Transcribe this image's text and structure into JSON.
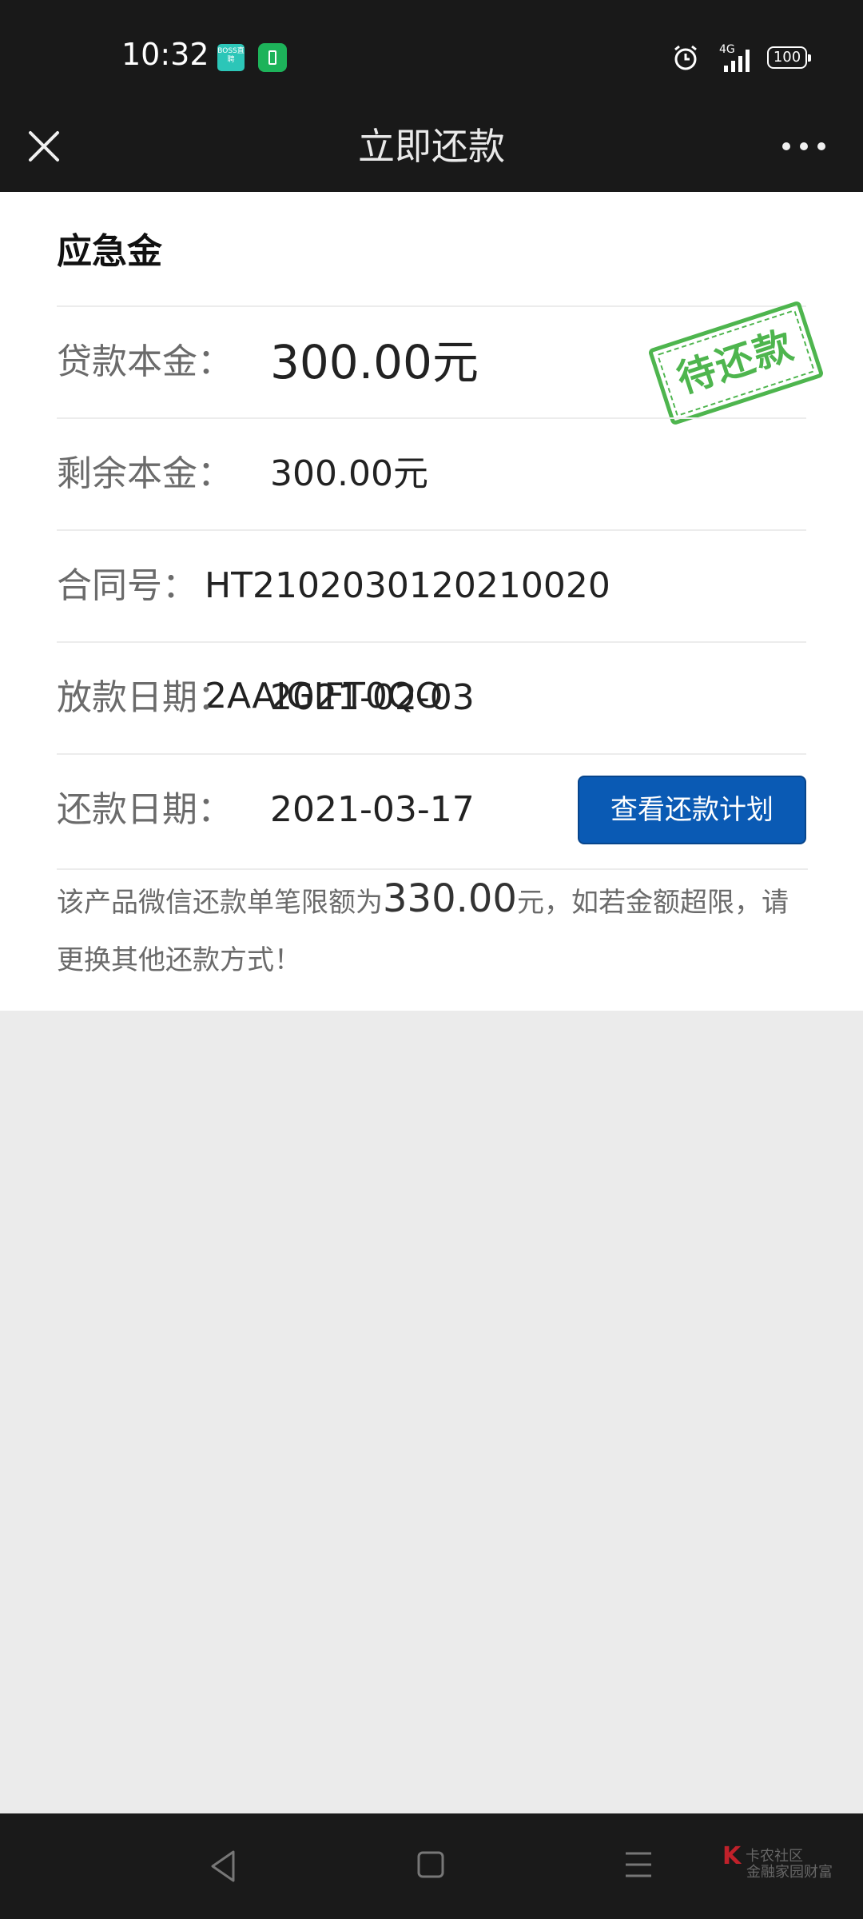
{
  "status_bar": {
    "time": "10:32",
    "app_icon_text": "BOSS直聘",
    "network": "4G",
    "battery": "100"
  },
  "nav": {
    "title": "立即还款"
  },
  "loan": {
    "product_name": "应急金",
    "stamp_text": "待还款",
    "rows": [
      {
        "label": "贷款本金：",
        "value": "300.00元"
      },
      {
        "label": "剩余本金：",
        "value": "300.00元"
      },
      {
        "label": "合同号：",
        "value": "HT2102030120210020 2AAIGIFT0QO"
      },
      {
        "label": "放款日期：",
        "value": "2021-02-03"
      },
      {
        "label": "还款日期：",
        "value": "2021-03-17"
      }
    ],
    "plan_button_label": "查看还款计划",
    "notice_prefix": "该产品微信还款单笔限额为",
    "notice_amount": "330.00",
    "notice_suffix": "元，如若金额超限，请更换其他还款方式！"
  },
  "watermark": {
    "logo": "K",
    "text_top": "卡农社区",
    "text_bottom": "金融家园财富"
  },
  "colors": {
    "bar_bg": "#191919",
    "button_blue": "#0a5ab4",
    "stamp_green": "#3bae3b"
  }
}
